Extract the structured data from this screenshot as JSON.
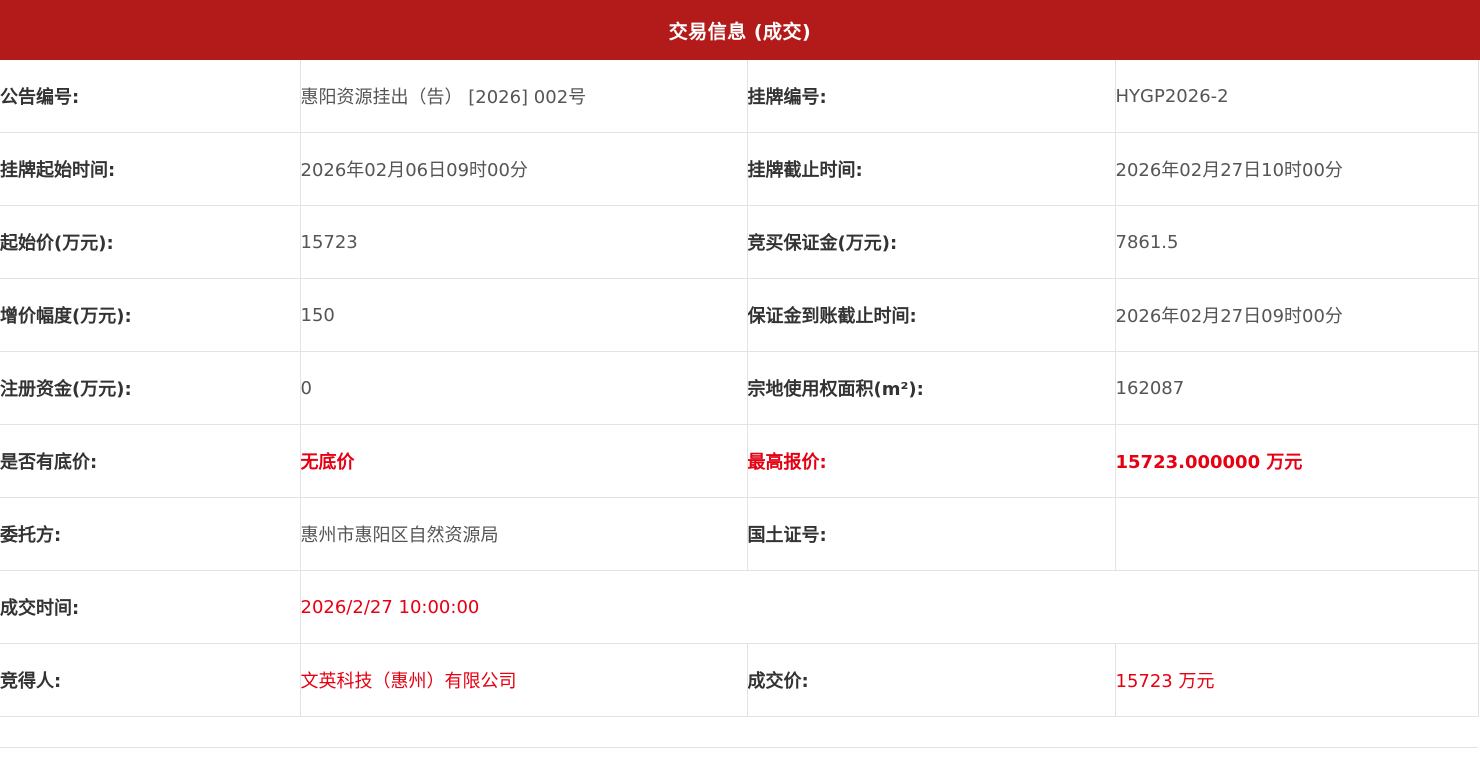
{
  "header": {
    "title": "交易信息 (成交)"
  },
  "colors": {
    "header_bg": "#b31b1b",
    "highlight": "#e60012"
  },
  "rows": [
    {
      "l1": "公告编号:",
      "v1": "惠阳资源挂出（告） [2026] 002号",
      "l2": "挂牌编号:",
      "v2": "HYGP2026-2"
    },
    {
      "l1": "挂牌起始时间:",
      "v1": "2026年02月06日09时00分",
      "l2": "挂牌截止时间:",
      "v2": "2026年02月27日10时00分"
    },
    {
      "l1": "起始价(万元):",
      "v1": "15723",
      "l2": "竞买保证金(万元):",
      "v2": "7861.5"
    },
    {
      "l1": "增价幅度(万元):",
      "v1": "150",
      "l2": "保证金到账截止时间:",
      "v2": "2026年02月27日09时00分"
    },
    {
      "l1": "注册资金(万元):",
      "v1": "0",
      "l2": "宗地使用权面积(m²):",
      "v2": "162087"
    },
    {
      "l1": "是否有底价:",
      "v1": "无底价",
      "l2": "最高报价:",
      "v2": "15723.000000 万元"
    },
    {
      "l1": "委托方:",
      "v1": "惠州市惠阳区自然资源局",
      "l2": "国土证号:",
      "v2": ""
    },
    {
      "l1": "成交时间:",
      "v1": "2026/2/27 10:00:00"
    },
    {
      "l1": "竞得人:",
      "v1": "文英科技（惠州）有限公司",
      "l2": "成交价:",
      "v2": "15723 万元"
    }
  ]
}
